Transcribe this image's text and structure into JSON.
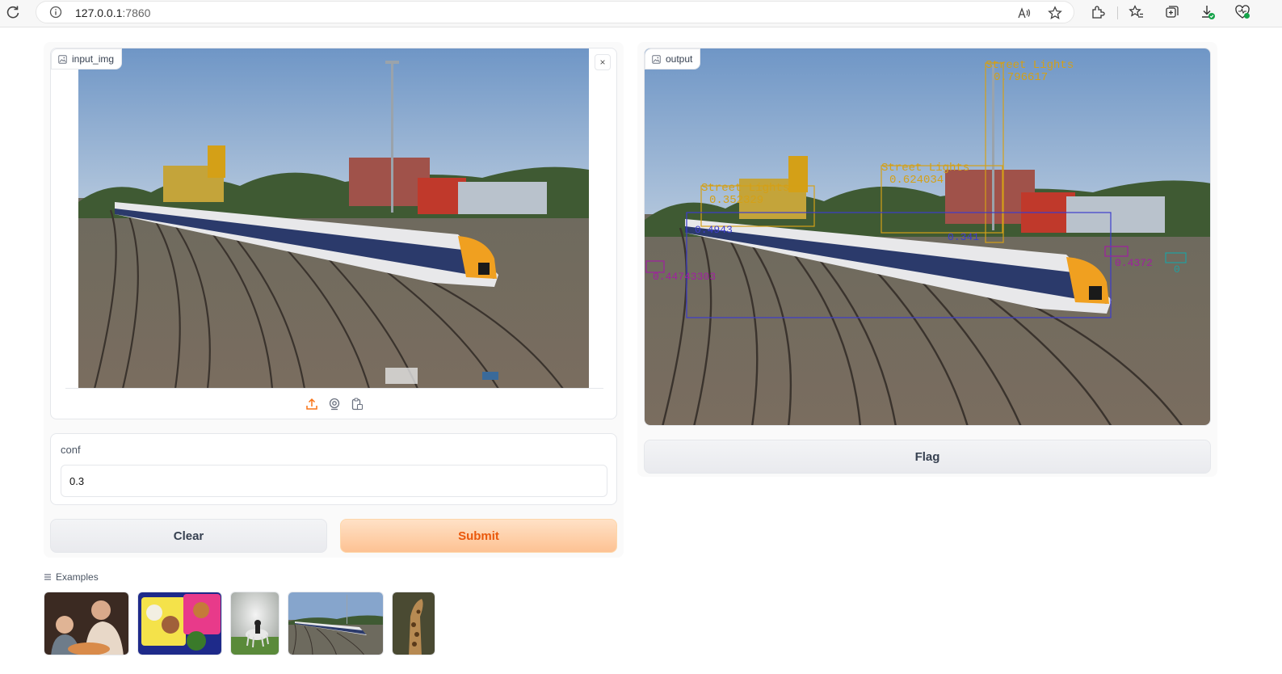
{
  "browser": {
    "url_host": "127.0.0.1",
    "url_port": ":7860"
  },
  "input_panel": {
    "label": "input_img",
    "close_glyph": "×",
    "source_icons": [
      "upload-icon",
      "webcam-icon",
      "clipboard-icon"
    ]
  },
  "conf": {
    "label": "conf",
    "value": "0.3"
  },
  "buttons": {
    "clear": "Clear",
    "submit": "Submit",
    "flag": "Flag"
  },
  "output_panel": {
    "label": "output",
    "detections": [
      {
        "label": "Street Lights",
        "score": "0.796617"
      },
      {
        "label": "Street Lights",
        "score": "0.624034"
      },
      {
        "label": "Street Lights",
        "score": "0.352329"
      },
      {
        "label": "",
        "score": "0.4943"
      },
      {
        "label": "",
        "score": "0.44743303"
      },
      {
        "label": "",
        "score": "0.341"
      },
      {
        "label": "",
        "score": "0.4372"
      },
      {
        "label": "",
        "score": "0"
      }
    ]
  },
  "examples": {
    "label": "Examples",
    "thumbnails": [
      "example-family-dining",
      "example-bento-box",
      "example-horse-rider",
      "example-train-yard",
      "example-giraffe"
    ]
  },
  "colors": {
    "accent": "#f97316",
    "detection_gold": "#d4a017",
    "detection_purple": "#a020a0",
    "detection_blue": "#3c3ccc"
  }
}
